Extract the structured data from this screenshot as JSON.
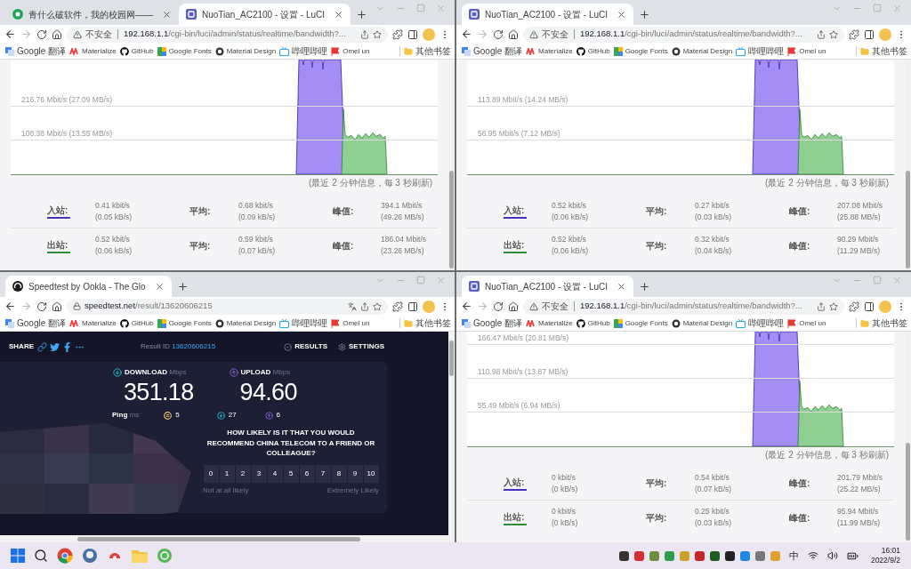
{
  "windows": [
    {
      "kind": "luci",
      "tabs": [
        {
          "kind": "article",
          "title": "青什么破软件，我的校园网——",
          "selected": false
        },
        {
          "kind": "luci",
          "title": "NuoTian_AC2100 - 设置 - LuCI",
          "selected": true
        }
      ],
      "security": {
        "kind": "insecure",
        "label": "不安全"
      },
      "host": "192.168.1.1",
      "path": "/cgi-bin/luci/admin/status/realtime/bandwidth?...",
      "bookmarks": [
        "Google 翻译",
        "Materialize",
        "GitHub",
        "Google Fonts",
        "Material Design",
        "哔哩哔哩",
        "Omel un"
      ],
      "other_bookmarks": "其他书签",
      "graph": {
        "gridlines": [
          "216.76 Mbit/s (27.09 MB/s)",
          "108.38 Mbit/s (13.55 MB/s)"
        ],
        "caption": "(最近 2 分钟信息，每 3 秒刷新)"
      },
      "stats": [
        {
          "label": "入站:",
          "color": "#4c2fbf",
          "current": [
            "0.41 kbit/s",
            "(0.05 kB/s)"
          ],
          "average_label": "平均:",
          "average": [
            "0.68 kbit/s",
            "(0.09 kB/s)"
          ],
          "peak_label": "峰值:",
          "peak": [
            "394.1 Mbit/s",
            "(49.26 MB/s)"
          ]
        },
        {
          "label": "出站:",
          "color": "#2e8b3a",
          "current": [
            "0.52 kbit/s",
            "(0.06 kB/s)"
          ],
          "average_label": "平均:",
          "average": [
            "0.59 kbit/s",
            "(0.07 kB/s)"
          ],
          "peak_label": "峰值:",
          "peak": [
            "186.04 Mbit/s",
            "(23.26 MB/s)"
          ]
        }
      ]
    },
    {
      "kind": "luci",
      "tabs": [
        {
          "kind": "luci",
          "title": "NuoTian_AC2100 - 设置 - LuCI",
          "selected": true
        }
      ],
      "security": {
        "kind": "insecure",
        "label": "不安全"
      },
      "host": "192.168.1.1",
      "path": "/cgi-bin/luci/admin/status/realtime/bandwidth?...",
      "bookmarks": [
        "Google 翻译",
        "Materialize",
        "GitHub",
        "Google Fonts",
        "Material Design",
        "哔哩哔哩",
        "Omel un"
      ],
      "other_bookmarks": "其他书签",
      "graph": {
        "gridlines": [
          "113.89 Mbit/s (14.24 MB/s)",
          "56.95 Mbit/s (7.12 MB/s)"
        ],
        "caption": "(最近 2 分钟信息，每 3 秒刷新)"
      },
      "stats": [
        {
          "label": "入站:",
          "color": "#4c2fbf",
          "current": [
            "0.52 kbit/s",
            "(0.06 kB/s)"
          ],
          "average_label": "平均:",
          "average": [
            "0.27 kbit/s",
            "(0.03 kB/s)"
          ],
          "peak_label": "峰值:",
          "peak": [
            "207.08 Mbit/s",
            "(25.88 MB/s)"
          ]
        },
        {
          "label": "出站:",
          "color": "#2e8b3a",
          "current": [
            "0.52 kbit/s",
            "(0.06 kB/s)"
          ],
          "average_label": "平均:",
          "average": [
            "0.32 kbit/s",
            "(0.04 kB/s)"
          ],
          "peak_label": "峰值:",
          "peak": [
            "90.29 Mbit/s",
            "(11.29 MB/s)"
          ]
        }
      ]
    },
    {
      "kind": "speedtest",
      "tabs": [
        {
          "kind": "speedtest",
          "title": "Speedtest by Ookla - The Glo",
          "selected": true
        }
      ],
      "security": {
        "kind": "secure"
      },
      "host": "speedtest.net",
      "path": "/result/13620606215",
      "bookmarks": [
        "Google 翻译",
        "Materialize",
        "GitHub",
        "Google Fonts",
        "Material Design",
        "哔哩哔哩",
        "Omel un"
      ],
      "other_bookmarks": "其他书签",
      "result": {
        "share": "SHARE",
        "result_id_label": "Result ID",
        "result_id": "13620606215",
        "nav": [
          "RESULTS",
          "SETTINGS"
        ],
        "download": {
          "label": "DOWNLOAD",
          "unit": "Mbps",
          "value": "351.18"
        },
        "upload": {
          "label": "UPLOAD",
          "unit": "Mbps",
          "value": "94.60"
        },
        "ping": {
          "label": "Ping",
          "unit": "ms",
          "idle": "5",
          "download": "27",
          "upload": "6"
        },
        "question": "HOW LIKELY IS IT THAT YOU WOULD RECOMMEND CHINA TELECOM TO A FRIEND OR COLLEAGUE?",
        "scale": [
          "0",
          "1",
          "2",
          "3",
          "4",
          "5",
          "6",
          "7",
          "8",
          "9",
          "10"
        ],
        "scale_low": "Not at all likely",
        "scale_high": "Extremely Likely"
      }
    },
    {
      "kind": "luci",
      "tabs": [
        {
          "kind": "luci",
          "title": "NuoTian_AC2100 - 设置 - LuCI",
          "selected": true
        }
      ],
      "security": {
        "kind": "insecure",
        "label": "不安全"
      },
      "host": "192.168.1.1",
      "path": "/cgi-bin/luci/admin/status/realtime/bandwidth?...",
      "bookmarks": [
        "Google 翻译",
        "Materialize",
        "GitHub",
        "Google Fonts",
        "Material Design",
        "哔哩哔哩",
        "Omel un"
      ],
      "other_bookmarks": "其他书签",
      "graph": {
        "gridlines": [
          "166.47 Mbit/s (20.81 MB/s)",
          "110.98 Mbit/s (13.87 MB/s)",
          "55.49 Mbit/s (6.94 MB/s)"
        ],
        "caption": "(最近 2 分钟信息，每 3 秒刷新)"
      },
      "stats": [
        {
          "label": "入站:",
          "color": "#4c2fbf",
          "current": [
            "0 kbit/s",
            "(0 kB/s)"
          ],
          "average_label": "平均:",
          "average": [
            "0.54 kbit/s",
            "(0.07 kB/s)"
          ],
          "peak_label": "峰值:",
          "peak": [
            "201.79 Mbit/s",
            "(25.22 MB/s)"
          ]
        },
        {
          "label": "出站:",
          "color": "#2e8b3a",
          "current": [
            "0 kbit/s",
            "(0 kB/s)"
          ],
          "average_label": "平均:",
          "average": [
            "0.25 kbit/s",
            "(0.03 kB/s)"
          ],
          "peak_label": "峰值:",
          "peak": [
            "95.94 Mbit/s",
            "(11.99 MB/s)"
          ]
        }
      ]
    }
  ],
  "taskbar": {
    "input_method": "中",
    "time": "16:01",
    "date": "2022/9/2"
  }
}
